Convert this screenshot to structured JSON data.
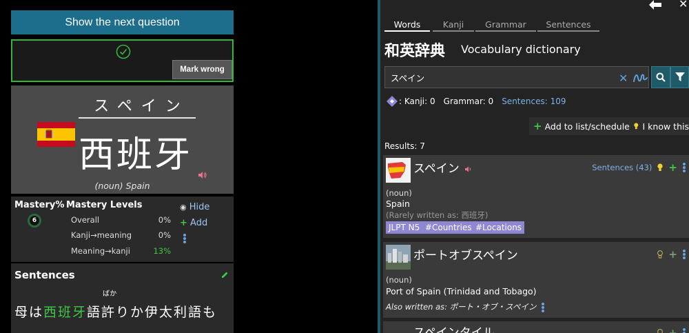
{
  "left": {
    "next_button": "Show the next question",
    "mark_wrong": "Mark wrong",
    "card": {
      "kana": "スペイン",
      "kanji": "西班牙",
      "meaning": "(noun) Spain"
    },
    "mastery": {
      "pct_label": "Mastery%",
      "pct_value": "6",
      "levels_title": "Mastery Levels",
      "levels": [
        {
          "label": "Overall",
          "pct": "0%"
        },
        {
          "label": "Kanji→meaning",
          "pct": "0%"
        },
        {
          "label": "Meaning→kanji",
          "pct": "13%"
        }
      ],
      "hide": "Hide",
      "add": "Add"
    },
    "sentences": {
      "title": "Sentences",
      "furigana": "ばか",
      "text_pre": "母は",
      "text_highlight": "西班牙",
      "text_post": "語許りか伊太利語も"
    }
  },
  "right": {
    "tabs": [
      "Words",
      "Kanji",
      "Grammar",
      "Sentences"
    ],
    "active_tab": "Words",
    "title_jp": "和英辞典",
    "title_en": "Vocabulary dictionary",
    "search": {
      "value": "スペイン",
      "placeholder": ""
    },
    "counts": {
      "kanji": ": Kanji: 0",
      "grammar": "Grammar: 0",
      "sentences": "Sentences: 109"
    },
    "add_list": "Add to list/schedule",
    "know_this": "I know this",
    "results_label": "Results: 7",
    "results": [
      {
        "word": "スペイン",
        "sentences": "Sentences (43)",
        "pos": "(noun)",
        "gloss": "Spain",
        "rare": "(Rarely written as: 西班牙)",
        "tags": [
          "JLPT N5",
          "#Countries",
          "#Locations"
        ]
      },
      {
        "word": "ポートオブスペイン",
        "pos": "(noun)",
        "gloss": "Port of Spain (Trinidad and Tobago)",
        "also_label": "Also written as",
        "also_value": ": ポート・オブ・スペイン"
      },
      {
        "word": "スペインタイル"
      }
    ]
  },
  "colors": {
    "accent_teal": "#1d6e8c",
    "success_green": "#3ec845",
    "link_blue": "#7cb2e8",
    "tag_purple": "#8e87d4"
  },
  "icons": [
    "check-circle-icon",
    "spain-flag-icon",
    "speaker-icon",
    "eye-icon",
    "plus-icon",
    "kebab-icon",
    "pencil-icon",
    "back-arrow-icon",
    "close-icon",
    "clear-icon",
    "handwriting-icon",
    "search-icon",
    "filter-icon",
    "diamond-icon",
    "bulb-icon"
  ]
}
